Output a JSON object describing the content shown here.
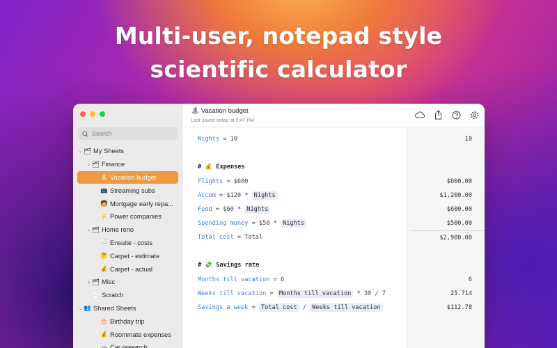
{
  "headline": {
    "line1": "Multi-user, notepad style",
    "line2": "scientific calculator"
  },
  "window": {
    "lights": [
      "#ff5f57",
      "#febc2e",
      "#28c840"
    ],
    "search_placeholder": "Search"
  },
  "sidebar": {
    "items": [
      {
        "label": "My Sheets",
        "icon": "🗂",
        "level": 0,
        "chevron": "⌄"
      },
      {
        "label": "Finance",
        "icon": "🗂",
        "level": 1,
        "chevron": "⌄"
      },
      {
        "label": "Vacation budget",
        "icon": "🏝",
        "level": 2,
        "selected": true
      },
      {
        "label": "Streaming subs",
        "icon": "📺",
        "level": 2
      },
      {
        "label": "Mortgage early repa...",
        "icon": "🧑",
        "level": 2
      },
      {
        "label": "Power companies",
        "icon": "⚡",
        "level": 2
      },
      {
        "label": "Home reno",
        "icon": "🗂",
        "level": 1,
        "chevron": "⌄"
      },
      {
        "label": "Ensuite - costs",
        "icon": "🛁",
        "level": 2
      },
      {
        "label": "Carpet - estimate",
        "icon": "🤔",
        "level": 2
      },
      {
        "label": "Carpet - actual",
        "icon": "💰",
        "level": 2
      },
      {
        "label": "Misc",
        "icon": "🗂",
        "level": 1,
        "chevron": "›"
      },
      {
        "label": "Scratch",
        "icon": "📄",
        "level": 1
      },
      {
        "label": "Shared Sheets",
        "icon": "👥",
        "level": 0,
        "chevron": "⌄"
      },
      {
        "label": "Birthday trip",
        "icon": "🎂",
        "level": 2
      },
      {
        "label": "Roommate expenses",
        "icon": "💰",
        "level": 2
      },
      {
        "label": "Car research",
        "icon": "🚗",
        "level": 2
      }
    ]
  },
  "document": {
    "title": "🏝 Vacation budget",
    "subtitle": "Last saved today at 5:47 PM"
  },
  "toolbar": {
    "icons": [
      "cloud-icon",
      "share-icon",
      "help-icon",
      "settings-icon"
    ]
  },
  "sheet": {
    "nights": {
      "var": "Nights",
      "eq": " = ",
      "val": "10",
      "result": "10"
    },
    "expenses_heading": {
      "hash": "#",
      "emoji": "💰",
      "text": "Expenses"
    },
    "flights": {
      "var": "Flights",
      "eq": " = $",
      "val": "600",
      "result": "$600.00"
    },
    "accom": {
      "var": "Accom",
      "eq": " = $",
      "val": "120",
      "op": " * ",
      "tok": "Nights",
      "result": "$1,200.00"
    },
    "food": {
      "var": "Food",
      "eq": " = $",
      "val": "60",
      "op": " * ",
      "tok": "Nights",
      "result": "$600.00"
    },
    "spending": {
      "var": "Spending money",
      "eq": " = $",
      "val": "50",
      "op": " * ",
      "tok": "Nights",
      "result": "$500.00"
    },
    "total": {
      "var": "Total cost",
      "eq": " = ",
      "val": "Total",
      "result": "$2,900.00"
    },
    "savings_heading": {
      "hash": "#",
      "emoji": "💸",
      "text": "Savings rate"
    },
    "months": {
      "var": "Months till vacation",
      "eq": " = ",
      "val": "6",
      "result": "6"
    },
    "weeks": {
      "var": "Weeks till vacation",
      "eq": " = ",
      "tok": "Months till vacation",
      "op": " * 30 / 7",
      "result": "25.714"
    },
    "savings": {
      "var": "Savings a week",
      "eq": " = ",
      "tok1": "Total cost",
      "op": " / ",
      "tok2": "Weeks till vacation",
      "result": "$112.78"
    }
  }
}
